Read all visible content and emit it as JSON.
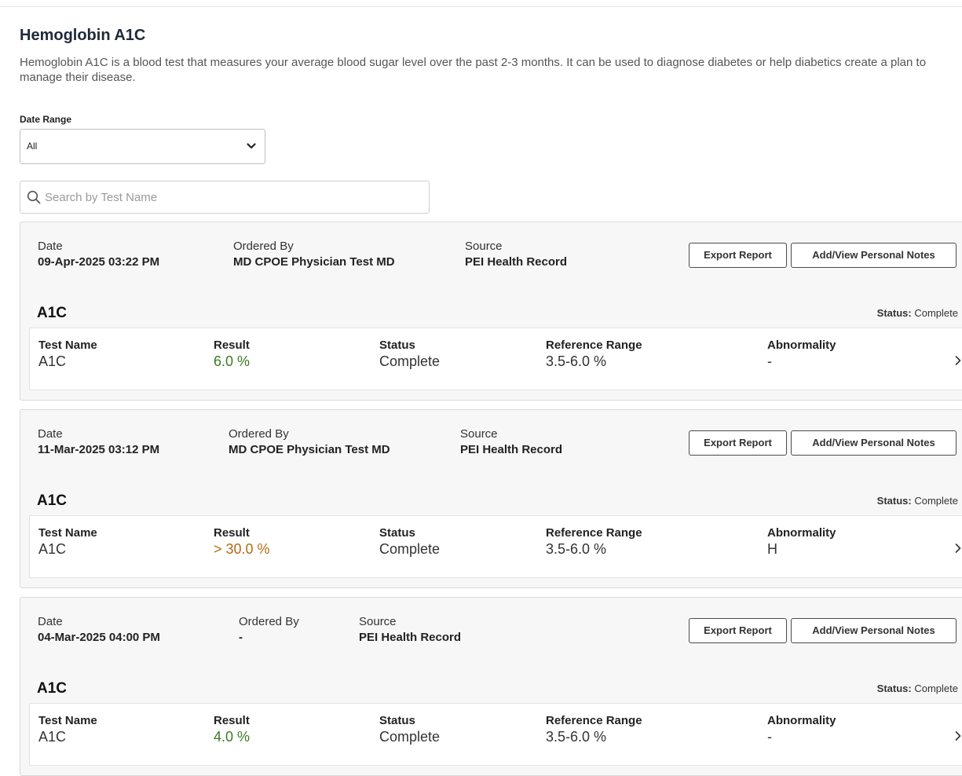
{
  "page": {
    "title": "Hemoglobin A1C",
    "description": "Hemoglobin A1C is a blood test that measures your average blood sugar level over the past 2-3 months. It can be used to diagnose diabetes or help diabetics create a plan to manage their disease."
  },
  "filters": {
    "date_range_label": "Date Range",
    "date_range_value": "All",
    "search_placeholder": "Search by Test Name",
    "search_value": ""
  },
  "labels": {
    "date": "Date",
    "ordered_by": "Ordered By",
    "source": "Source",
    "export_report": "Export Report",
    "personal_notes": "Add/View Personal Notes",
    "status_prefix": "Status:",
    "col_test_name": "Test Name",
    "col_result": "Result",
    "col_status": "Status",
    "col_reference_range": "Reference Range",
    "col_abnormality": "Abnormality"
  },
  "colors": {
    "result_normal": "#3b7a23",
    "result_abnormal": "#b06d12"
  },
  "icons": {
    "search": "search-icon",
    "dropdown": "chevron-down-icon",
    "row_expand": "chevron-right-icon"
  },
  "records": [
    {
      "date": "09-Apr-2025 03:22 PM",
      "ordered_by": "MD CPOE Physician Test MD",
      "source": "PEI Health Record",
      "test_title": "A1C",
      "status": "Complete",
      "row": {
        "test_name": "A1C",
        "result": "6.0 %",
        "status": "Complete",
        "reference_range": "3.5-6.0 %",
        "abnormality": "-"
      }
    },
    {
      "date": "11-Mar-2025 03:12 PM",
      "ordered_by": "MD CPOE Physician Test MD",
      "source": "PEI Health Record",
      "test_title": "A1C",
      "status": "Complete",
      "row": {
        "test_name": "A1C",
        "result": "> 30.0 %",
        "status": "Complete",
        "reference_range": "3.5-6.0 %",
        "abnormality": "H"
      }
    },
    {
      "date": "04-Mar-2025 04:00 PM",
      "ordered_by": "-",
      "source": "PEI Health Record",
      "test_title": "A1C",
      "status": "Complete",
      "row": {
        "test_name": "A1C",
        "result": "4.0 %",
        "status": "Complete",
        "reference_range": "3.5-6.0 %",
        "abnormality": "-"
      }
    }
  ]
}
